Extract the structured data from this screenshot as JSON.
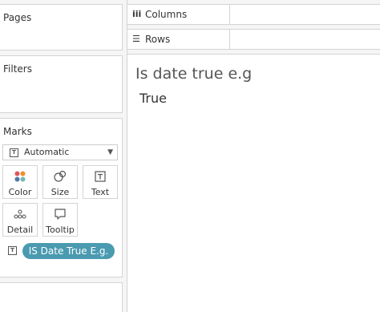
{
  "cards": {
    "pages": {
      "title": "Pages"
    },
    "filters": {
      "title": "Filters"
    },
    "marks": {
      "title": "Marks",
      "mark_type": "Automatic",
      "buttons": {
        "color": "Color",
        "size": "Size",
        "text": "Text",
        "detail": "Detail",
        "tooltip": "Tooltip"
      },
      "pill": {
        "label": "IS Date True E.g.",
        "color": "#4a9ab0"
      }
    }
  },
  "shelves": {
    "columns": {
      "label": "Columns",
      "icon": "columns-icon"
    },
    "rows": {
      "label": "Rows",
      "icon": "rows-icon"
    }
  },
  "view": {
    "title": "Is date true e.g",
    "value": "True"
  }
}
